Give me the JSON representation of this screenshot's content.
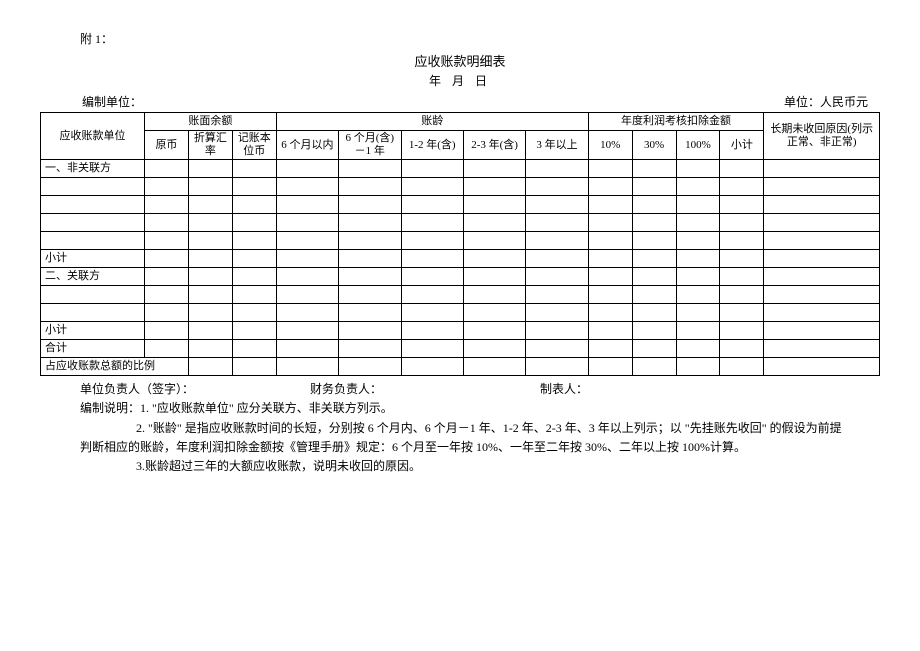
{
  "attachment": "附 1：",
  "title": "应收账款明细表",
  "date": "年  月  日",
  "prep_unit_label": "编制单位：",
  "currency_unit_label": "单位：人民币元",
  "headers": {
    "unit": "应收账款单位",
    "book_balance": "账面余额",
    "aging": "账龄",
    "deduction": "年度利润考核扣除金额",
    "reason": "长期未收回原因(列示正常、非正常)",
    "orig_currency": "原币",
    "exchange_rate": "折算汇率",
    "bookkeeping_currency": "记账本位币",
    "within_6m": "6 个月以内",
    "m6_1y": "6 个月(含)－1 年",
    "y1_2": "1-2 年(含)",
    "y2_3": "2-3 年(含)",
    "over_3y": "3 年以上",
    "p10": "10%",
    "p30": "30%",
    "p100": "100%",
    "subtotal": "小计"
  },
  "rows": {
    "non_related": "一、非关联方",
    "subtotal": "小计",
    "related": "二、关联方",
    "total": "合计",
    "ratio": "占应收账款总额的比例"
  },
  "signers": {
    "unit_head": "单位负责人（签字）：",
    "finance_head": "财务负责人：",
    "preparer": "制表人："
  },
  "notes": {
    "line1": "编制说明：1. \"应收账款单位\" 应分关联方、非关联方列示。",
    "line2a": "2. \"账龄\" 是指应收账款时间的长短，分别按 6 个月内、6 个月－1 年、1-2 年、2-3 年、3 年以上列示；以 \"先挂账先收回\" 的假设为前提",
    "line2b": "判断相应的账龄，年度利润扣除金额按《管理手册》规定：6 个月至一年按 10%、一年至二年按 30%、二年以上按 100%计算。",
    "line3": "3.账龄超过三年的大额应收账款，说明未收回的原因。"
  }
}
